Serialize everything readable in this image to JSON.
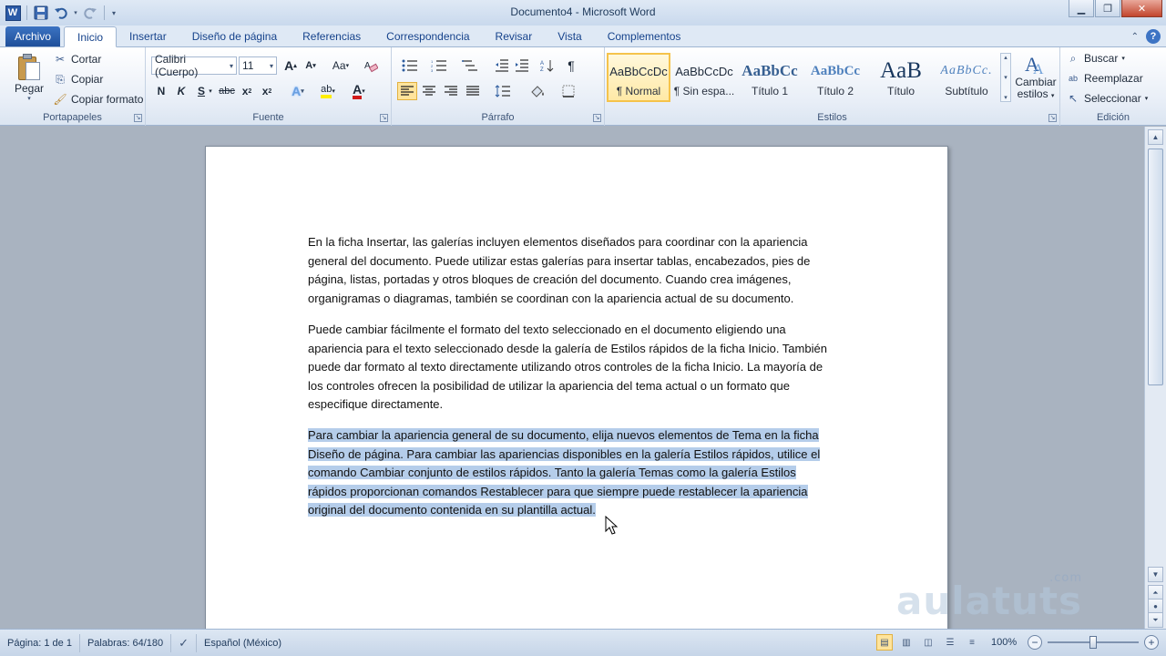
{
  "window": {
    "title": "Documento4 - Microsoft Word",
    "app_logo": "W"
  },
  "tabs": [
    {
      "label": "Archivo",
      "kind": "file"
    },
    {
      "label": "Inicio",
      "kind": "active"
    },
    {
      "label": "Insertar"
    },
    {
      "label": "Diseño de página"
    },
    {
      "label": "Referencias"
    },
    {
      "label": "Correspondencia"
    },
    {
      "label": "Revisar"
    },
    {
      "label": "Vista"
    },
    {
      "label": "Complementos"
    }
  ],
  "clipboard": {
    "paste_label": "Pegar",
    "cut_label": "Cortar",
    "copy_label": "Copiar",
    "format_painter_label": "Copiar formato",
    "group_label": "Portapapeles"
  },
  "font": {
    "name": "Calibri (Cuerpo)",
    "size": "11",
    "grow_label": "A",
    "shrink_label": "A",
    "case_label": "Aa",
    "bold_label": "N",
    "italic_label": "K",
    "underline_label": "S",
    "strike_label": "abc",
    "sub_label": "x",
    "sub_suffix": "2",
    "sup_label": "x",
    "sup_suffix": "2",
    "effects_label": "A",
    "highlight_label": "ab",
    "color_label": "A",
    "group_label": "Fuente"
  },
  "paragraph": {
    "pilcrow": "¶",
    "group_label": "Párrafo"
  },
  "styles": {
    "items": [
      {
        "sample": "AaBbCcDc",
        "name": "¶ Normal",
        "selected": true
      },
      {
        "sample": "AaBbCcDc",
        "name": "¶ Sin espa...",
        "selected": false
      },
      {
        "sample": "AaBbCc",
        "name": "Título 1",
        "selected": false
      },
      {
        "sample": "AaBbCc",
        "name": "Título 2",
        "selected": false
      },
      {
        "sample": "AaB",
        "name": "Título",
        "selected": false
      },
      {
        "sample": "AaBbCc.",
        "name": "Subtítulo",
        "selected": false
      }
    ],
    "change_styles_line1": "Cambiar",
    "change_styles_line2": "estilos",
    "group_label": "Estilos"
  },
  "editing": {
    "find_label": "Buscar",
    "replace_label": "Reemplazar",
    "select_label": "Seleccionar",
    "group_label": "Edición"
  },
  "document": {
    "paragraphs": [
      "En la ficha Insertar, las galerías incluyen elementos diseñados para coordinar con la apariencia general del documento. Puede utilizar estas galerías para insertar tablas, encabezados, pies de página, listas, portadas y otros bloques de creación del documento. Cuando crea imágenes, organigramas o diagramas, también se coordinan con la apariencia actual de su documento.",
      "Puede cambiar fácilmente el formato del texto seleccionado en el documento eligiendo una apariencia para el texto seleccionado desde la galería de Estilos rápidos de la ficha Inicio. También puede dar formato al texto directamente utilizando otros controles de la ficha Inicio. La mayoría de los controles ofrecen la posibilidad de utilizar la apariencia del tema actual o un formato que especifique directamente.",
      "Para cambiar la apariencia general de su documento, elija nuevos elementos de Tema en la ficha Diseño de página. Para cambiar las apariencias disponibles en la galería Estilos rápidos, utilice el comando Cambiar conjunto de estilos rápidos. Tanto la galería Temas como la galería Estilos rápidos proporcionan comandos Restablecer para que siempre puede restablecer la apariencia original del documento contenida en su plantilla actual."
    ],
    "selected_paragraph_index": 2
  },
  "watermark": {
    "text": "aulatuts",
    "suffix": ".com"
  },
  "status": {
    "page": "Página: 1 de 1",
    "words": "Palabras: 64/180",
    "language": "Español (México)",
    "zoom": "100%",
    "zoom_percent": 100
  },
  "colors": {
    "accent": "#2b579a",
    "selection": "#b5cdea"
  }
}
